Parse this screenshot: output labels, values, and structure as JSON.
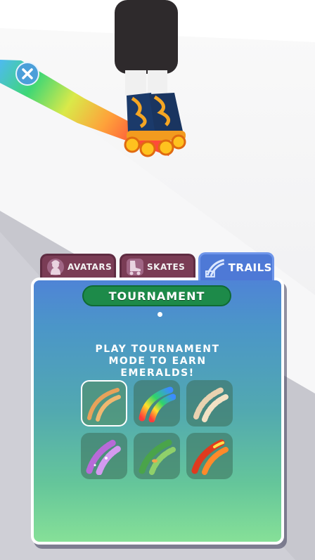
{
  "tabs": [
    {
      "label": "AVATARS"
    },
    {
      "label": "SKATES"
    },
    {
      "label": "TRAILS"
    }
  ],
  "panel": {
    "mode_button": "TOURNAMENT",
    "message_lines": [
      "PLAY TOURNAMENT",
      "MODE TO EARN",
      "EMERALDS!"
    ]
  },
  "trails": [
    {
      "name": "classic-trail",
      "selected": true
    },
    {
      "name": "rainbow-trail",
      "selected": false
    },
    {
      "name": "sand-trail",
      "selected": false
    },
    {
      "name": "purple-sparkle-trail",
      "selected": false
    },
    {
      "name": "leaf-trail",
      "selected": false
    },
    {
      "name": "fire-trail",
      "selected": false
    }
  ],
  "colors": {
    "tab_inactive": "#7a3c55",
    "tab_active": "#4e79d6",
    "tournament_button": "#1d8a49",
    "close_button": "#4b9fd9"
  },
  "icons": [
    "close-icon",
    "avatar-icon",
    "skate-icon",
    "trail-icon"
  ]
}
